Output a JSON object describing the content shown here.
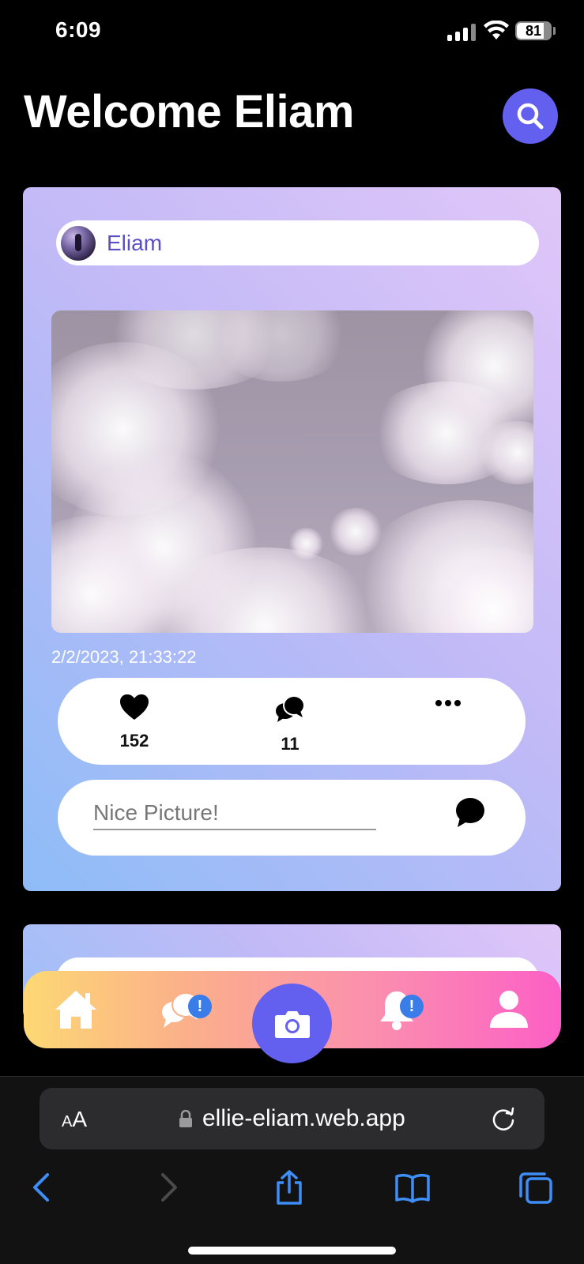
{
  "status_bar": {
    "time": "6:09",
    "battery": "81"
  },
  "header": {
    "title": "Welcome Eliam"
  },
  "post": {
    "author": "Eliam",
    "timestamp": "2/2/2023, 21:33:22",
    "likes": "152",
    "comments": "11",
    "comment_placeholder": "Nice Picture!"
  },
  "nav": {
    "chat_badge": "!",
    "notifications_badge": "!"
  },
  "browser": {
    "text_size_label_small": "A",
    "text_size_label_large": "A",
    "url": "ellie-eliam.web.app"
  },
  "colors": {
    "accent": "#6360f0",
    "badge": "#3b7de8",
    "browser_blue": "#3e8ef7"
  }
}
